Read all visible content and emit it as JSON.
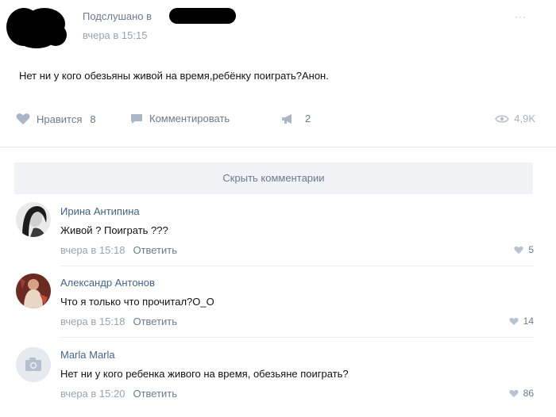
{
  "post": {
    "author": "Подслушано в",
    "time": "вчера в 15:15",
    "menu_glyph": "···",
    "text": "Нет ни у кого обезьяны живой на время,ребёнку поиграть?Анон."
  },
  "actions": {
    "like_label": "Нравится",
    "like_count": "8",
    "comment_label": "Комментировать",
    "share_count": "2",
    "views": "4,9K"
  },
  "comments_toggle": "Скрыть комментарии",
  "comments": [
    {
      "name": "Ирина Антипина",
      "text": "Живой ? Поиграть ???",
      "time": "вчера в 15:18",
      "reply": "Ответить",
      "likes": "5"
    },
    {
      "name": "Александр Антонов",
      "text": "Что я только что прочитал?О_О",
      "time": "вчера в 15:18",
      "reply": "Ответить",
      "likes": "14"
    },
    {
      "name": "Marla Marla",
      "text": "Нет ни у кого ребенка живого на время, обезьяне поиграть?",
      "time": "вчера в 15:20",
      "reply": "Ответить",
      "likes": "86"
    }
  ],
  "colors": {
    "link": "#42648b",
    "muted": "#9aa3ad",
    "action": "#6b7a8f",
    "bar": "#f0f2f5"
  },
  "icons": [
    "heart-icon",
    "comment-icon",
    "share-megaphone-icon",
    "eye-icon",
    "camera-placeholder-icon"
  ]
}
